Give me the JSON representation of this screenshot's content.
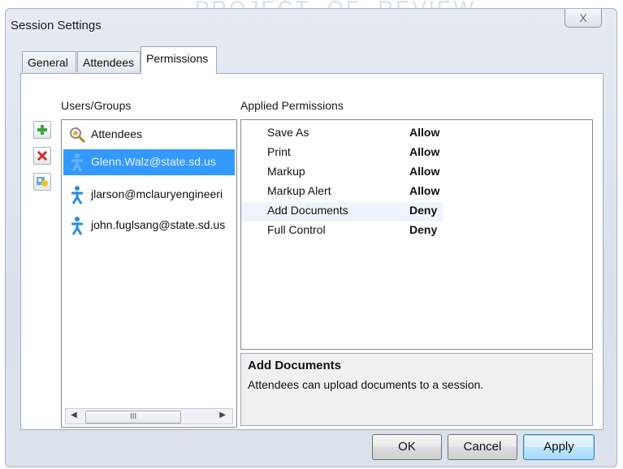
{
  "window": {
    "title": "Session Settings",
    "close_label": "X"
  },
  "tabs": [
    {
      "label": "General"
    },
    {
      "label": "Attendees"
    },
    {
      "label": "Permissions",
      "active": true
    }
  ],
  "users_groups": {
    "label": "Users/Groups",
    "buttons": {
      "add_icon": "plus-icon",
      "remove_icon": "red-x-icon",
      "properties_icon": "user-properties-icon"
    },
    "items": [
      {
        "label": "Attendees",
        "icon": "attendees-group-icon",
        "selected": false
      },
      {
        "label": "Glenn.Walz@state.sd.us",
        "icon": "person-icon",
        "selected": true
      },
      {
        "label": "jlarson@mclauryengineeri",
        "icon": "person-icon",
        "selected": false
      },
      {
        "label": "john.fuglsang@state.sd.us",
        "icon": "person-icon",
        "selected": false
      }
    ],
    "scrollbar_thumb": "III"
  },
  "applied_permissions": {
    "label": "Applied Permissions",
    "rows": [
      {
        "name": "Save As",
        "value": "Allow"
      },
      {
        "name": "Print",
        "value": "Allow"
      },
      {
        "name": "Markup",
        "value": "Allow"
      },
      {
        "name": "Markup Alert",
        "value": "Allow"
      },
      {
        "name": "Add Documents",
        "value": "Deny",
        "highlighted": true
      },
      {
        "name": "Full Control",
        "value": "Deny"
      }
    ]
  },
  "description": {
    "title": "Add Documents",
    "text": "Attendees can upload documents to a session."
  },
  "buttons": {
    "ok": "OK",
    "cancel": "Cancel",
    "apply": "Apply"
  },
  "colors": {
    "selection": "#3399ff",
    "person_icon": "#2a8fe0",
    "remove_red": "#d42a2a",
    "add_green": "#3aa83a"
  }
}
